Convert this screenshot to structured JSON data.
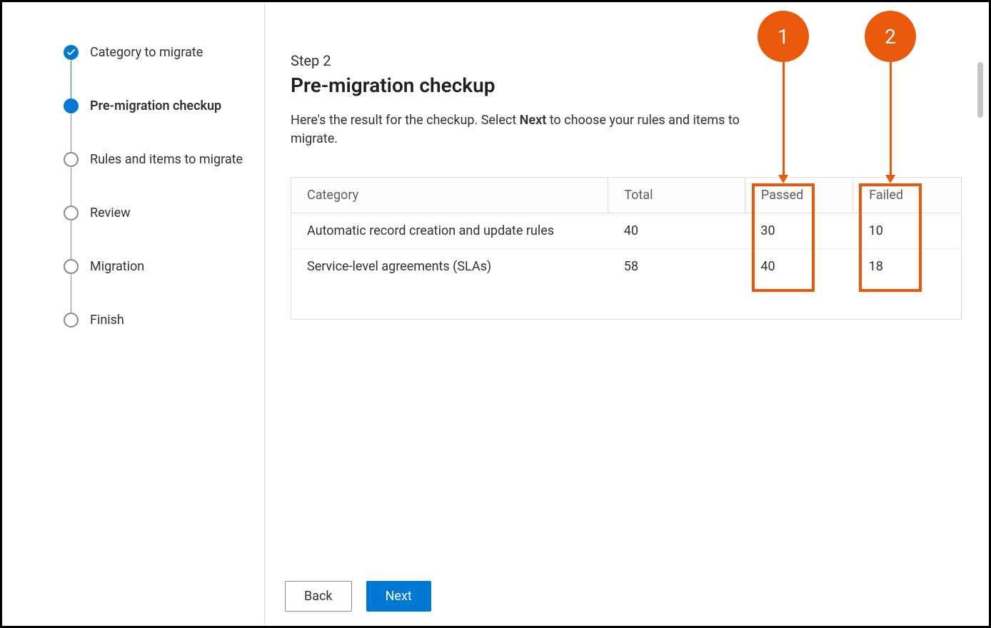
{
  "sidebar": {
    "steps": [
      {
        "label": "Category to migrate",
        "state": "completed"
      },
      {
        "label": "Pre-migration checkup",
        "state": "current"
      },
      {
        "label": "Rules and items to migrate",
        "state": "pending"
      },
      {
        "label": "Review",
        "state": "pending"
      },
      {
        "label": "Migration",
        "state": "pending"
      },
      {
        "label": "Finish",
        "state": "pending"
      }
    ]
  },
  "main": {
    "step_number": "Step 2",
    "title": "Pre-migration checkup",
    "description_pre": "Here's the result for the checkup. Select ",
    "description_bold": "Next",
    "description_post": " to choose your rules and items to migrate.",
    "table": {
      "headers": {
        "category": "Category",
        "total": "Total",
        "passed": "Passed",
        "failed": "Failed"
      },
      "rows": [
        {
          "category": "Automatic record creation and update rules",
          "total": "40",
          "passed": "30",
          "failed": "10"
        },
        {
          "category": "Service-level agreements (SLAs)",
          "total": "58",
          "passed": "40",
          "failed": "18"
        }
      ]
    }
  },
  "footer": {
    "back_label": "Back",
    "next_label": "Next"
  },
  "callouts": {
    "one": "1",
    "two": "2"
  },
  "colors": {
    "accent": "#0078d4",
    "annotation": "#e8590c"
  }
}
